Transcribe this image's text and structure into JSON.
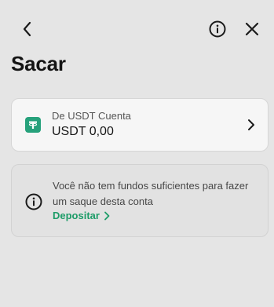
{
  "header": {
    "back_icon": "chevron-left-icon",
    "info_icon": "info-circle-icon",
    "close_icon": "close-icon"
  },
  "page": {
    "title": "Sacar"
  },
  "account": {
    "icon": "tether-usdt-icon",
    "label": "De USDT Cuenta",
    "value": "USDT 0,00",
    "chevron_icon": "chevron-right-icon",
    "brand_color": "#26a17b"
  },
  "notice": {
    "icon": "info-circle-icon",
    "message": "Você não tem fundos suficientes para fazer um saque desta conta",
    "link_label": "Depositar",
    "link_color": "#1d9c68"
  }
}
